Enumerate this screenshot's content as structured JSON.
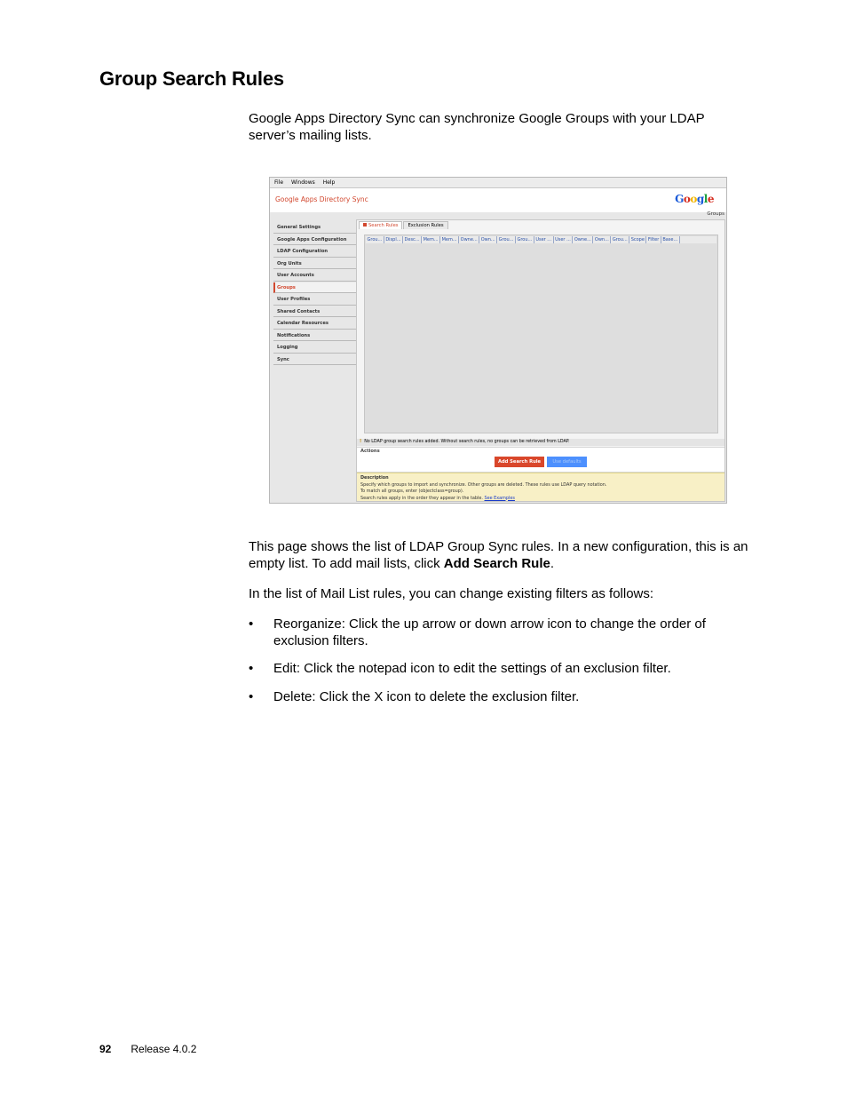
{
  "heading": "Group Search Rules",
  "intro": "Google Apps Directory Sync can synchronize Google Groups with your LDAP server’s mailing lists.",
  "screenshot": {
    "menu": [
      "File",
      "Windows",
      "Help"
    ],
    "app_title": "Google Apps Directory Sync",
    "logo": "Google",
    "page_label": "Groups",
    "nav": [
      "General Settings",
      "Google Apps Configuration",
      "LDAP Configuration",
      "Org Units",
      "User Accounts",
      "Groups",
      "User Profiles",
      "Shared Contacts",
      "Calendar Resources",
      "Notifications",
      "Logging",
      "Sync"
    ],
    "active_nav_index": 5,
    "tabs": [
      "Search Rules",
      "Exclusion Rules"
    ],
    "columns": [
      "Grou...",
      "Displ...",
      "Desc...",
      "Mem...",
      "Mem...",
      "Owne...",
      "Own...",
      "Grou...",
      "Grou...",
      "User ...",
      "User ...",
      "Owne...",
      "Own...",
      "Grou...",
      "Scope",
      "Filter",
      "Base..."
    ],
    "warning": "No LDAP group search rules added. Without search rules, no groups can be retrieved from LDAP.",
    "actions_label": "Actions",
    "add_button": "Add Search Rule",
    "defaults_button": "Use defaults",
    "desc_title": "Description",
    "desc_line1": "Specify which groups to import and synchronize. Other groups are deleted. These rules use LDAP query notation.",
    "desc_line2": "To match all groups, enter (objectclass=group).",
    "desc_line3": "Search rules apply in the order they appear in the table.",
    "desc_link": "See Examples",
    "colors": {
      "accent": "#d2472e",
      "button_blue": "#4d90fe",
      "desc_bg": "#f8f0c6"
    }
  },
  "body": {
    "p1_a": "This page shows the list of LDAP Group Sync rules. In a new configuration, this is an empty list. To add mail lists, click ",
    "p1_bold": "Add Search Rule",
    "p1_end": ".",
    "p2": "In the list of Mail List rules, you can change existing filters as follows:",
    "bullet_char": "•",
    "bullets": [
      "Reorganize: Click the up arrow or down arrow icon to change the order of exclusion filters.",
      "Edit: Click the notepad icon to edit the settings of an exclusion filter.",
      "Delete: Click the X icon to delete the exclusion filter."
    ]
  },
  "footer": {
    "page_number": "92",
    "release": "Release 4.0.2"
  }
}
